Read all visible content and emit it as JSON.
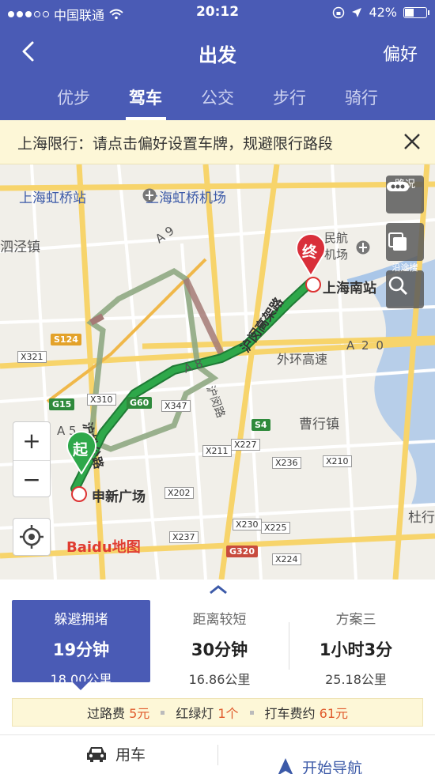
{
  "status": {
    "carrier": "中国联通",
    "time": "20:12",
    "battery": "42%"
  },
  "header": {
    "title": "出发",
    "pref": "偏好"
  },
  "tabs": [
    "优步",
    "驾车",
    "公交",
    "步行",
    "骑行"
  ],
  "notice": {
    "text": "上海限行：请点击偏好设置车牌，规避限行路段"
  },
  "map": {
    "places": {
      "hongqiao_station": "上海虹桥站",
      "hongqiao_airport": "上海虹桥机场",
      "sijing": "泗泾镇",
      "minhang_airport": "民航\n机场",
      "south_station": "上海南站",
      "caohang": "曹行镇",
      "duhang": "杜行",
      "shenxin": "申新广场",
      "outer_ring": "外环高速",
      "hu_min": "沪闵高架路",
      "humin_road": "沪闵路",
      "xin_song": "沪松公路"
    },
    "roads": [
      "A 9",
      "A 8",
      "A 2 0",
      "A 5",
      "S124",
      "X321",
      "G15",
      "G60",
      "X310",
      "X347",
      "S4",
      "X227",
      "X211",
      "X236",
      "X210",
      "X202",
      "X230",
      "X225",
      "X237",
      "G320",
      "X224"
    ],
    "controls": {
      "traffic": "路况",
      "along_search": "沿途搜"
    },
    "start_label": "起",
    "end_label": "终",
    "logo": "Baidu地图"
  },
  "plans": [
    {
      "name": "躲避拥堵",
      "duration": "19分钟",
      "distance": "18.00公里"
    },
    {
      "name": "距离较短",
      "duration": "30分钟",
      "distance": "16.86公里"
    },
    {
      "name": "方案三",
      "duration": "1小时3分",
      "distance": "25.18公里"
    }
  ],
  "fees": {
    "toll_label": "过路费",
    "toll_value": "5元",
    "lights_label": "红绿灯",
    "lights_value": "1个",
    "taxi_label": "打车费约",
    "taxi_value": "61元"
  },
  "actions": {
    "car": "用车",
    "navigate": "开始导航"
  },
  "colors": {
    "header": "#4a5bb5",
    "route": "#2ea84a",
    "accent": "#e05a2b"
  }
}
